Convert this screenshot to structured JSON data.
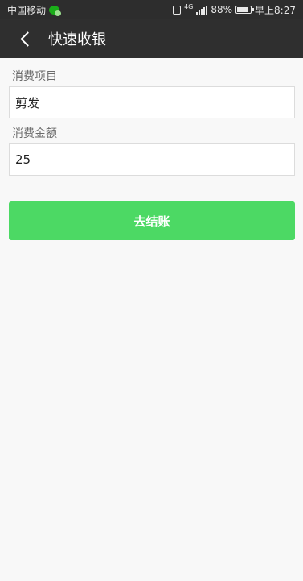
{
  "status_bar": {
    "carrier": "中国移动",
    "battery": "88%",
    "time": "早上8:27",
    "network_label": "4G"
  },
  "header": {
    "title": "快速收银"
  },
  "form": {
    "item_label": "消费项目",
    "item_value": "剪发",
    "amount_label": "消费金额",
    "amount_value": "25"
  },
  "actions": {
    "checkout_label": "去结账",
    "checkout_color": "#4cd964"
  },
  "colors": {
    "header_bg": "#2f2f2f",
    "page_bg": "#f8f8f8"
  }
}
